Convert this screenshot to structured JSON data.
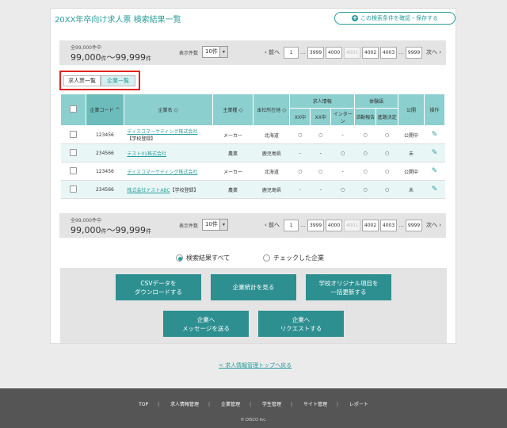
{
  "header": {
    "title": "20XX年卒向け求人票 検索結果一覧",
    "save_button": "この検索条件を確認・保存する"
  },
  "pagination": {
    "total_label": "全99,000件中",
    "range_from": "99,000",
    "range_unit1": "件",
    "range_sep": "～",
    "range_to": "99,999",
    "range_unit2": "件",
    "per_page_label": "表示件数",
    "per_page_value": "10件",
    "prev": "前へ",
    "next": "次へ",
    "pages": [
      "1",
      "3999",
      "4000",
      "4001",
      "4002",
      "4003",
      "9999"
    ],
    "current_page": "4001",
    "ellipsis": "…"
  },
  "tabs": {
    "job_list": "求人票一覧",
    "company_list": "企業一覧"
  },
  "table": {
    "headers": {
      "code": "企業コード",
      "name": "企業名",
      "industry": "主業種",
      "hq": "本社所在地",
      "job_info": "求人情報",
      "job_xx1": "XX中",
      "job_xx2": "XX中",
      "internship": "インターン",
      "exam": "体験語",
      "activity_report": "活動報告",
      "course_decision": "進路決定",
      "public": "公開",
      "action": "操作"
    },
    "rows": [
      {
        "code": "123456",
        "name": "ディスコマーケティング株式会社",
        "tag": "【学校登録】",
        "industry": "メーカー",
        "hq": "北海道",
        "c1": "○",
        "c2": "○",
        "c3": "-",
        "c4": "○",
        "c5": "○",
        "public": "公開中"
      },
      {
        "code": "234566",
        "name": "テスト01株式会社",
        "tag": "",
        "industry": "農業",
        "hq": "鹿児島県",
        "c1": "-",
        "c2": "-",
        "c3": "○",
        "c4": "○",
        "c5": "○",
        "public": "未"
      },
      {
        "code": "123456",
        "name": "ディスコマーケティング株式会社",
        "tag": "",
        "industry": "メーカー",
        "hq": "北海道",
        "c1": "○",
        "c2": "○",
        "c3": "-",
        "c4": "○",
        "c5": "○",
        "public": "公開中"
      },
      {
        "code": "234566",
        "name": "株式会社テストABC",
        "tag": "【学校登録】",
        "industry": "農業",
        "hq": "鹿児島県",
        "c1": "-",
        "c2": "-",
        "c3": "○",
        "c4": "○",
        "c5": "○",
        "public": "未"
      }
    ]
  },
  "radio": {
    "all": "検索結果すべて",
    "checked": "チェックした企業"
  },
  "actions": {
    "csv": "CSVデータを\nダウンロードする",
    "stats": "企業統計を見る",
    "bulk": "学校オリジナル項目を\n一括更新する",
    "message": "企業へ\nメッセージを送る",
    "request": "企業へ\nリクエストする"
  },
  "back_link": "< 求人情報管理トップへ戻る",
  "footer": {
    "links": [
      "TOP",
      "求人情報管理",
      "企業管理",
      "学生管理",
      "サイト管理",
      "レポート"
    ],
    "copyright": "© DISCO Inc."
  },
  "colors": {
    "accent": "#2a9d9c",
    "header_bg": "#8ccfcf",
    "button": "#2e8f91",
    "highlight": "#e0251f"
  }
}
